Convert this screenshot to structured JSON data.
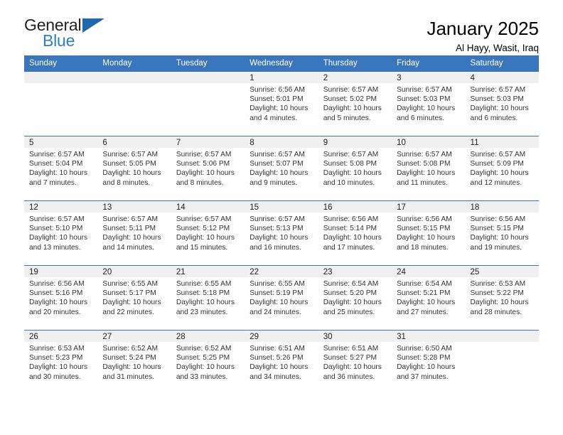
{
  "brand": {
    "name_top": "General",
    "name_bottom": "Blue",
    "accent_color": "#2a7fc9",
    "triangle_color": "#1d69ab"
  },
  "header": {
    "title": "January 2025",
    "subtitle": "Al Hayy, Wasit, Iraq"
  },
  "calendar": {
    "header_bg": "#3a76bd",
    "daynum_bg": "#f0f0f0",
    "weekdays": [
      "Sunday",
      "Monday",
      "Tuesday",
      "Wednesday",
      "Thursday",
      "Friday",
      "Saturday"
    ],
    "weeks": [
      [
        {
          "day": "",
          "lines": []
        },
        {
          "day": "",
          "lines": []
        },
        {
          "day": "",
          "lines": []
        },
        {
          "day": "1",
          "lines": [
            "Sunrise: 6:56 AM",
            "Sunset: 5:01 PM",
            "Daylight: 10 hours",
            "and 4 minutes."
          ]
        },
        {
          "day": "2",
          "lines": [
            "Sunrise: 6:57 AM",
            "Sunset: 5:02 PM",
            "Daylight: 10 hours",
            "and 5 minutes."
          ]
        },
        {
          "day": "3",
          "lines": [
            "Sunrise: 6:57 AM",
            "Sunset: 5:03 PM",
            "Daylight: 10 hours",
            "and 6 minutes."
          ]
        },
        {
          "day": "4",
          "lines": [
            "Sunrise: 6:57 AM",
            "Sunset: 5:03 PM",
            "Daylight: 10 hours",
            "and 6 minutes."
          ]
        }
      ],
      [
        {
          "day": "5",
          "lines": [
            "Sunrise: 6:57 AM",
            "Sunset: 5:04 PM",
            "Daylight: 10 hours",
            "and 7 minutes."
          ]
        },
        {
          "day": "6",
          "lines": [
            "Sunrise: 6:57 AM",
            "Sunset: 5:05 PM",
            "Daylight: 10 hours",
            "and 8 minutes."
          ]
        },
        {
          "day": "7",
          "lines": [
            "Sunrise: 6:57 AM",
            "Sunset: 5:06 PM",
            "Daylight: 10 hours",
            "and 8 minutes."
          ]
        },
        {
          "day": "8",
          "lines": [
            "Sunrise: 6:57 AM",
            "Sunset: 5:07 PM",
            "Daylight: 10 hours",
            "and 9 minutes."
          ]
        },
        {
          "day": "9",
          "lines": [
            "Sunrise: 6:57 AM",
            "Sunset: 5:08 PM",
            "Daylight: 10 hours",
            "and 10 minutes."
          ]
        },
        {
          "day": "10",
          "lines": [
            "Sunrise: 6:57 AM",
            "Sunset: 5:08 PM",
            "Daylight: 10 hours",
            "and 11 minutes."
          ]
        },
        {
          "day": "11",
          "lines": [
            "Sunrise: 6:57 AM",
            "Sunset: 5:09 PM",
            "Daylight: 10 hours",
            "and 12 minutes."
          ]
        }
      ],
      [
        {
          "day": "12",
          "lines": [
            "Sunrise: 6:57 AM",
            "Sunset: 5:10 PM",
            "Daylight: 10 hours",
            "and 13 minutes."
          ]
        },
        {
          "day": "13",
          "lines": [
            "Sunrise: 6:57 AM",
            "Sunset: 5:11 PM",
            "Daylight: 10 hours",
            "and 14 minutes."
          ]
        },
        {
          "day": "14",
          "lines": [
            "Sunrise: 6:57 AM",
            "Sunset: 5:12 PM",
            "Daylight: 10 hours",
            "and 15 minutes."
          ]
        },
        {
          "day": "15",
          "lines": [
            "Sunrise: 6:57 AM",
            "Sunset: 5:13 PM",
            "Daylight: 10 hours",
            "and 16 minutes."
          ]
        },
        {
          "day": "16",
          "lines": [
            "Sunrise: 6:56 AM",
            "Sunset: 5:14 PM",
            "Daylight: 10 hours",
            "and 17 minutes."
          ]
        },
        {
          "day": "17",
          "lines": [
            "Sunrise: 6:56 AM",
            "Sunset: 5:15 PM",
            "Daylight: 10 hours",
            "and 18 minutes."
          ]
        },
        {
          "day": "18",
          "lines": [
            "Sunrise: 6:56 AM",
            "Sunset: 5:15 PM",
            "Daylight: 10 hours",
            "and 19 minutes."
          ]
        }
      ],
      [
        {
          "day": "19",
          "lines": [
            "Sunrise: 6:56 AM",
            "Sunset: 5:16 PM",
            "Daylight: 10 hours",
            "and 20 minutes."
          ]
        },
        {
          "day": "20",
          "lines": [
            "Sunrise: 6:55 AM",
            "Sunset: 5:17 PM",
            "Daylight: 10 hours",
            "and 22 minutes."
          ]
        },
        {
          "day": "21",
          "lines": [
            "Sunrise: 6:55 AM",
            "Sunset: 5:18 PM",
            "Daylight: 10 hours",
            "and 23 minutes."
          ]
        },
        {
          "day": "22",
          "lines": [
            "Sunrise: 6:55 AM",
            "Sunset: 5:19 PM",
            "Daylight: 10 hours",
            "and 24 minutes."
          ]
        },
        {
          "day": "23",
          "lines": [
            "Sunrise: 6:54 AM",
            "Sunset: 5:20 PM",
            "Daylight: 10 hours",
            "and 25 minutes."
          ]
        },
        {
          "day": "24",
          "lines": [
            "Sunrise: 6:54 AM",
            "Sunset: 5:21 PM",
            "Daylight: 10 hours",
            "and 27 minutes."
          ]
        },
        {
          "day": "25",
          "lines": [
            "Sunrise: 6:53 AM",
            "Sunset: 5:22 PM",
            "Daylight: 10 hours",
            "and 28 minutes."
          ]
        }
      ],
      [
        {
          "day": "26",
          "lines": [
            "Sunrise: 6:53 AM",
            "Sunset: 5:23 PM",
            "Daylight: 10 hours",
            "and 30 minutes."
          ]
        },
        {
          "day": "27",
          "lines": [
            "Sunrise: 6:52 AM",
            "Sunset: 5:24 PM",
            "Daylight: 10 hours",
            "and 31 minutes."
          ]
        },
        {
          "day": "28",
          "lines": [
            "Sunrise: 6:52 AM",
            "Sunset: 5:25 PM",
            "Daylight: 10 hours",
            "and 33 minutes."
          ]
        },
        {
          "day": "29",
          "lines": [
            "Sunrise: 6:51 AM",
            "Sunset: 5:26 PM",
            "Daylight: 10 hours",
            "and 34 minutes."
          ]
        },
        {
          "day": "30",
          "lines": [
            "Sunrise: 6:51 AM",
            "Sunset: 5:27 PM",
            "Daylight: 10 hours",
            "and 36 minutes."
          ]
        },
        {
          "day": "31",
          "lines": [
            "Sunrise: 6:50 AM",
            "Sunset: 5:28 PM",
            "Daylight: 10 hours",
            "and 37 minutes."
          ]
        },
        {
          "day": "",
          "lines": []
        }
      ]
    ]
  }
}
